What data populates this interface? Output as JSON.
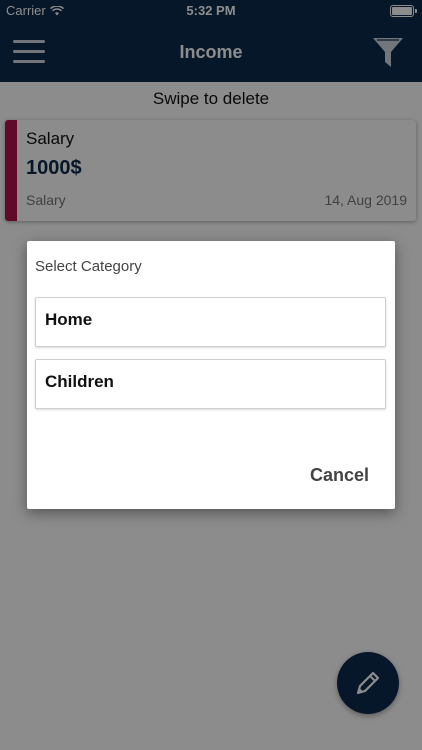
{
  "status_bar": {
    "carrier": "Carrier",
    "time": "5:32 PM"
  },
  "header": {
    "title": "Income",
    "menu_icon": "hamburger-menu-icon",
    "filter_icon": "filter-funnel-icon"
  },
  "main": {
    "swipe_hint": "Swipe to delete",
    "income_items": [
      {
        "title": "Salary",
        "amount": "1000$",
        "category": "Salary",
        "date": "14, Aug 2019",
        "accent_color": "#b0124a"
      }
    ],
    "fab_icon": "pencil-icon"
  },
  "dialog": {
    "title": "Select Category",
    "options": [
      "Home",
      "Children"
    ],
    "cancel_label": "Cancel"
  },
  "colors": {
    "nav_background": "#0d2a4d",
    "card_accent": "#b0124a",
    "amount_text": "#0d2a4d"
  }
}
